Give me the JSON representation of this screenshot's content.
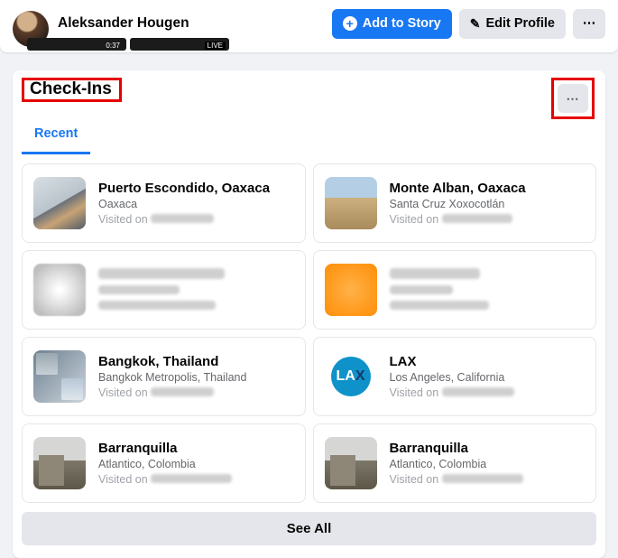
{
  "header": {
    "profile_name": "Aleksander Hougen",
    "add_to_story": "Add to Story",
    "edit_profile": "Edit Profile",
    "more": "⋯"
  },
  "panel": {
    "title": "Check-Ins",
    "more": "⋯",
    "tab_recent": "Recent",
    "see_all": "See All"
  },
  "checkins": {
    "pe": {
      "title": "Puerto Escondido, Oaxaca",
      "sub": "Oaxaca",
      "meta_prefix": "Visited on "
    },
    "ma": {
      "title": "Monte Alban, Oaxaca",
      "sub": "Santa Cruz Xoxocotlán",
      "meta_prefix": "Visited on "
    },
    "bkk": {
      "title": "Bangkok, Thailand",
      "sub": "Bangkok Metropolis, Thailand",
      "meta_prefix": "Visited on "
    },
    "lax": {
      "title": "LAX",
      "sub": "Los Angeles, California",
      "meta_prefix": "Visited on ",
      "logo": "LAX"
    },
    "bq1": {
      "title": "Barranquilla",
      "sub": "Atlantico, Colombia",
      "meta_prefix": "Visited on "
    },
    "bq2": {
      "title": "Barranquilla",
      "sub": "Atlantico, Colombia",
      "meta_prefix": "Visited on "
    }
  }
}
